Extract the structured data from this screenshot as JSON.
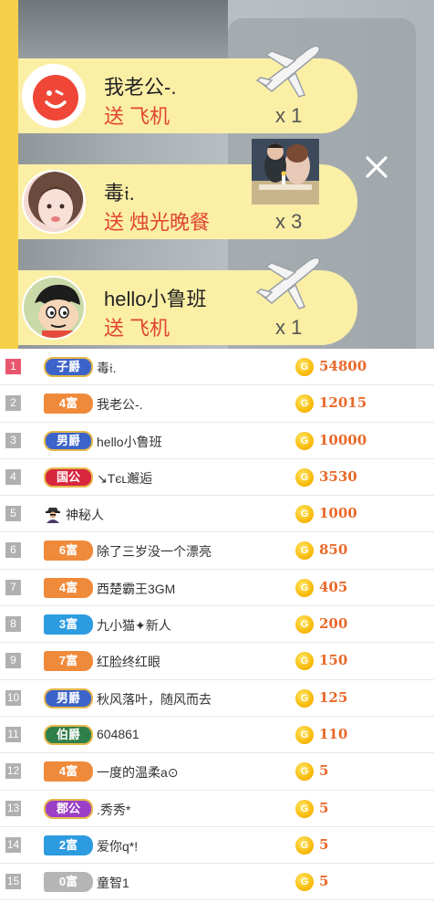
{
  "gifts": [
    {
      "name": "我老公-.",
      "verb": "送",
      "gift": "飞机",
      "count": "x 1",
      "gift_icon": "airplane-icon",
      "avatar": "smiley-avatar"
    },
    {
      "name": "毒𝔦.",
      "verb": "送",
      "gift": "烛光晚餐",
      "count": "x 3",
      "gift_icon": "candlelight-dinner-photo",
      "avatar": "girl-avatar"
    },
    {
      "name": "hello小鲁班",
      "verb": "送",
      "gift": "飞机",
      "count": "x 1",
      "gift_icon": "airplane-icon",
      "avatar": "cartoon-boy-avatar"
    }
  ],
  "ranking": [
    {
      "rank": "1",
      "badge": "子爵",
      "badge_type": "nobility",
      "badge_color": "#3b63c9",
      "name": "毒𝔦.",
      "amount": "54800"
    },
    {
      "rank": "2",
      "badge": "4富",
      "badge_type": "rich",
      "badge_color": "#f08a3b",
      "name": "我老公-.",
      "amount": "12015"
    },
    {
      "rank": "3",
      "badge": "男爵",
      "badge_type": "nobility",
      "badge_color": "#3b63c9",
      "name": "hello小鲁班",
      "amount": "10000"
    },
    {
      "rank": "4",
      "badge": "国公",
      "badge_type": "nobility",
      "badge_color": "#d8263e",
      "name": "↘Tєʟ邂逅",
      "amount": "3530"
    },
    {
      "rank": "5",
      "badge": "",
      "badge_type": "mystery",
      "badge_color": "",
      "name": "神秘人",
      "amount": "1000"
    },
    {
      "rank": "6",
      "badge": "6富",
      "badge_type": "rich",
      "badge_color": "#f08a3b",
      "name": "除了三岁没一个漂亮",
      "amount": "850"
    },
    {
      "rank": "7",
      "badge": "4富",
      "badge_type": "rich",
      "badge_color": "#f08a3b",
      "name": "西楚霸王3GM",
      "amount": "405"
    },
    {
      "rank": "8",
      "badge": "3富",
      "badge_type": "rich",
      "badge_color": "#2d9be0",
      "name": "九小猫✦新人",
      "amount": "200"
    },
    {
      "rank": "9",
      "badge": "7富",
      "badge_type": "rich",
      "badge_color": "#f08a3b",
      "name": "红脸终红眼",
      "amount": "150"
    },
    {
      "rank": "10",
      "badge": "男爵",
      "badge_type": "nobility",
      "badge_color": "#3b63c9",
      "name": "秋风落叶，随风而去",
      "amount": "125"
    },
    {
      "rank": "11",
      "badge": "伯爵",
      "badge_type": "nobility",
      "badge_color": "#2f7f4a",
      "name": "604861",
      "amount": "110"
    },
    {
      "rank": "12",
      "badge": "4富",
      "badge_type": "rich",
      "badge_color": "#f08a3b",
      "name": "一度的温柔a⊙",
      "amount": "5"
    },
    {
      "rank": "13",
      "badge": "郡公",
      "badge_type": "nobility",
      "badge_color": "#9b3fc6",
      "name": ".秀秀*",
      "amount": "5"
    },
    {
      "rank": "14",
      "badge": "2富",
      "badge_type": "rich",
      "badge_color": "#2d9be0",
      "name": "爱你q*!",
      "amount": "5"
    },
    {
      "rank": "15",
      "badge": "0富",
      "badge_type": "rich",
      "badge_color": "#b5b5b5",
      "name": "童智1",
      "amount": "5"
    }
  ],
  "coin_symbol": "G",
  "colors": {
    "accent": "#e8692a",
    "gift_bar": "#fbefa6",
    "gift_text": "#e0462e",
    "stripe": "#f6d04a"
  }
}
